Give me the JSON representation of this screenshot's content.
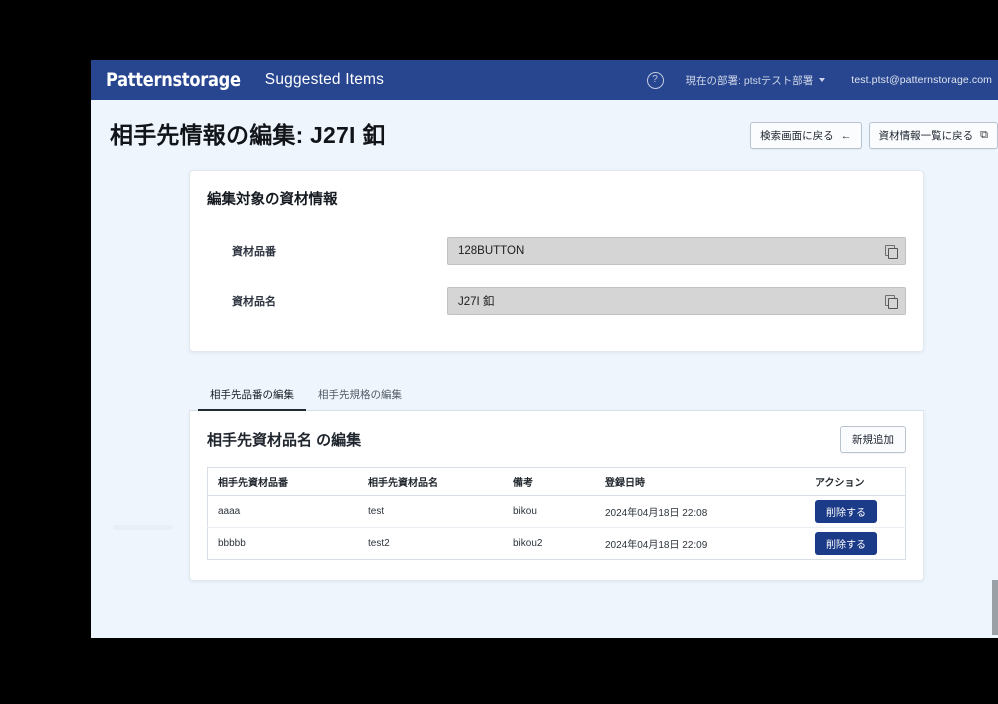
{
  "navbar": {
    "brand": "Patternstorage",
    "app_title": "Suggested Items",
    "help_icon": "question-mark-circle",
    "department": "現在の部署: ptstテスト部署",
    "user_email": "test.ptst@patternstorage.com",
    "bg_color": "#27468f"
  },
  "page": {
    "title": "相手先情報の編集: J27I 釦",
    "background_color": "#eef5fd",
    "buttons": [
      {
        "label": "検索画面に戻る",
        "glyph": "←"
      },
      {
        "label": "資材情報一覧に戻る",
        "glyph": "⧉"
      }
    ]
  },
  "info_card": {
    "heading": "編集対象の資材情報",
    "fields": [
      {
        "label": "資材品番",
        "value": "128BUTTON",
        "action_icon": "copy-icon"
      },
      {
        "label": "資材品名",
        "value": "J27I 釦",
        "action_icon": "copy-icon"
      }
    ]
  },
  "tabs": [
    {
      "label": "相手先品番の編集",
      "active": true
    },
    {
      "label": "相手先規格の編集",
      "active": false
    }
  ],
  "table_card": {
    "title": "相手先資材品名 の編集",
    "add_button": "新規追加",
    "columns": [
      "相手先資材品番",
      "相手先資材品名",
      "備考",
      "登録日時",
      "アクション"
    ],
    "rows": [
      {
        "code": "aaaa",
        "name": "test",
        "note": "bikou",
        "registered_at": "2024年04月18日 22:08",
        "action": "削除する"
      },
      {
        "code": "bbbbb",
        "name": "test2",
        "note": "bikou2",
        "registered_at": "2024年04月18日 22:09",
        "action": "削除する"
      }
    ],
    "delete_button_color": "#1b3a87"
  }
}
